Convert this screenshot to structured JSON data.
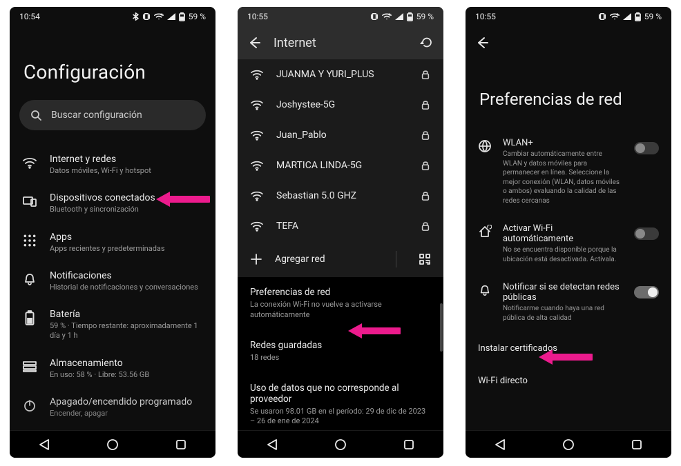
{
  "screen1": {
    "status": {
      "time": "10:54",
      "battery": "59 %"
    },
    "title": "Configuración",
    "search_placeholder": "Buscar configuración",
    "items": [
      {
        "icon": "wifi",
        "title": "Internet y redes",
        "sub": "Datos móviles, Wi-Fi y hotspot"
      },
      {
        "icon": "devices",
        "title": "Dispositivos conectados",
        "sub": "Bluetooth y sincronización"
      },
      {
        "icon": "apps",
        "title": "Apps",
        "sub": "Apps recientes y predeterminadas"
      },
      {
        "icon": "bell",
        "title": "Notificaciones",
        "sub": "Historial de notificaciones y conversaciones"
      },
      {
        "icon": "battery",
        "title": "Batería",
        "sub": "59 % · Tiempo restante: aproximadamente 1 día y 1 h"
      },
      {
        "icon": "storage",
        "title": "Almacenamiento",
        "sub": "En uso: 58 % · Libre: 53.56 GB"
      },
      {
        "icon": "power",
        "title": "Apagado/encendido programado",
        "sub": "Encender, apagar"
      }
    ]
  },
  "screen2": {
    "status": {
      "time": "10:55",
      "battery": "59 %"
    },
    "appbar_title": "Internet",
    "networks": [
      "JUANMA Y YURI_PLUS",
      "Joshystee-5G",
      "Juan_Pablo",
      "MARTICA LINDA-5G",
      "Sebastian 5.0 GHZ",
      "TEFA"
    ],
    "add_network": "Agregar red",
    "sections": [
      {
        "title": "Preferencias de red",
        "sub": "La conexión Wi-Fi no vuelve a activarse automáticamente"
      },
      {
        "title": "Redes guardadas",
        "sub": "18 redes"
      },
      {
        "title": "Uso de datos que no corresponde al proveedor",
        "sub": "Se usaron 98.01 GB en el período: 29 de dic de 2023 – 26 de ene de 2024"
      }
    ]
  },
  "screen3": {
    "status": {
      "time": "10:55",
      "battery": "59 %"
    },
    "title": "Preferencias de red",
    "prefs": [
      {
        "icon": "globe",
        "title": "WLAN+",
        "sub": "Cambiar automáticamente entre WLAN y datos móviles para permanecer en línea. Seleccione la mejor conexión (WLAN, datos móviles o ambos) evaluando la calidad de las redes cercanas",
        "switch": "off"
      },
      {
        "icon": "home-arrow",
        "title": "Activar Wi-Fi automáticamente",
        "sub": "No se encuentra disponible porque la ubicación está desactivada. Actívala.",
        "switch": "off"
      },
      {
        "icon": "bell",
        "title": "Notificar si se detectan redes públicas",
        "sub": "Notificarme cuando haya una red pública de alta calidad",
        "switch": "on"
      }
    ],
    "simple": [
      "Instalar certificados",
      "Wi-Fi directo"
    ]
  }
}
